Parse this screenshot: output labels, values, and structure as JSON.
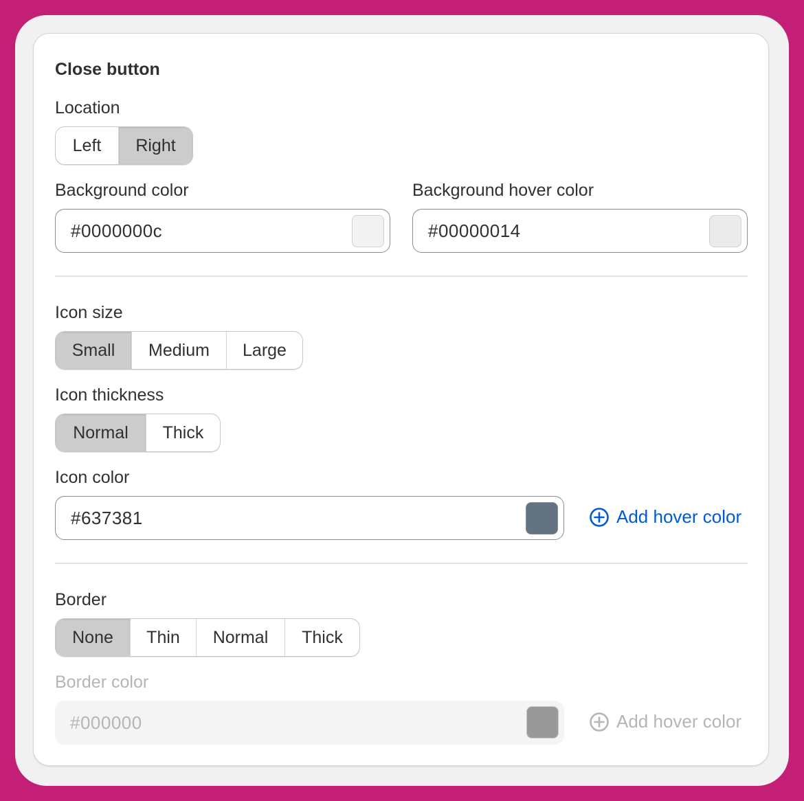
{
  "panel": {
    "title": "Close button"
  },
  "location": {
    "label": "Location",
    "options": [
      "Left",
      "Right"
    ],
    "selected": "Right"
  },
  "background": {
    "color_label": "Background color",
    "color_value": "#0000000c",
    "color_swatch": "#f2f2f2",
    "hover_label": "Background hover color",
    "hover_value": "#00000014",
    "hover_swatch": "#ebebeb"
  },
  "icon_size": {
    "label": "Icon size",
    "options": [
      "Small",
      "Medium",
      "Large"
    ],
    "selected": "Small"
  },
  "icon_thickness": {
    "label": "Icon thickness",
    "options": [
      "Normal",
      "Thick"
    ],
    "selected": "Normal"
  },
  "icon_color": {
    "label": "Icon color",
    "value": "#637381",
    "swatch": "#637381",
    "add_hover_label": "Add hover color"
  },
  "border": {
    "label": "Border",
    "options": [
      "None",
      "Thin",
      "Normal",
      "Thick"
    ],
    "selected": "None"
  },
  "border_color": {
    "label": "Border color",
    "placeholder": "#000000",
    "swatch": "#999999",
    "add_hover_label": "Add hover color"
  },
  "colors": {
    "accent": "#005bd3",
    "page_background": "#c41f77",
    "selected_segment": "#cccccc"
  }
}
